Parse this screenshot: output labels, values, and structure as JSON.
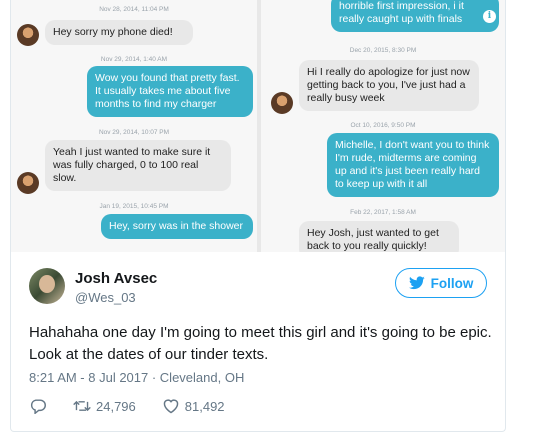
{
  "left_panel": {
    "messages": [
      {
        "timestamp": "Nov 28, 2014, 11:04 PM",
        "text": "Hey sorry my phone died!",
        "direction": "in"
      },
      {
        "timestamp": "Nov 29, 2014, 1:40 AM",
        "text": "Wow you found that pretty fast. It usually takes me about  five months to find my charger",
        "direction": "out"
      },
      {
        "timestamp": "Nov 29, 2014, 10:07 PM",
        "text": "Yeah I just wanted to make sure it was fully charged, 0 to 100 real slow.",
        "direction": "in"
      },
      {
        "timestamp": "Jan 19, 2015, 10:45 PM",
        "text": "Hey, sorry was in the shower",
        "direction": "out"
      }
    ]
  },
  "right_panel": {
    "messages": [
      {
        "timestamp": "",
        "text": "horrible first impression, i it really caught up with finals",
        "direction": "out"
      },
      {
        "timestamp": "Dec 20, 2015, 8:30 PM",
        "text": "Hi I really do apologize for just now getting back to you, I've just had a really busy week",
        "direction": "in"
      },
      {
        "timestamp": "Oct 10, 2016, 9:50 PM",
        "text": "Michelle, I don't want you to think I'm rude, midterms are coming up and it's just been really hard to keep up with it all",
        "direction": "out"
      },
      {
        "timestamp": "Feb 22, 2017, 1:58 AM",
        "text": "Hey Josh, just wanted to get back to you really quickly!",
        "direction": "in"
      }
    ]
  },
  "tweet": {
    "author_name": "Josh Avsec",
    "handle": "@Wes_03",
    "follow_label": "Follow",
    "text": "Hahahaha one day I'm going to meet this girl and it's going to be epic. Look at the dates of our tinder texts.",
    "timestamp": "8:21 AM - 8 Jul 2017 · Cleveland, OH",
    "retweets": "24,796",
    "likes": "81,492"
  },
  "colors": {
    "accent": "#1da1f2",
    "outgoing_bubble": "#3bb1c9",
    "incoming_bubble": "#e8e8e8",
    "secondary_text": "#657786"
  }
}
